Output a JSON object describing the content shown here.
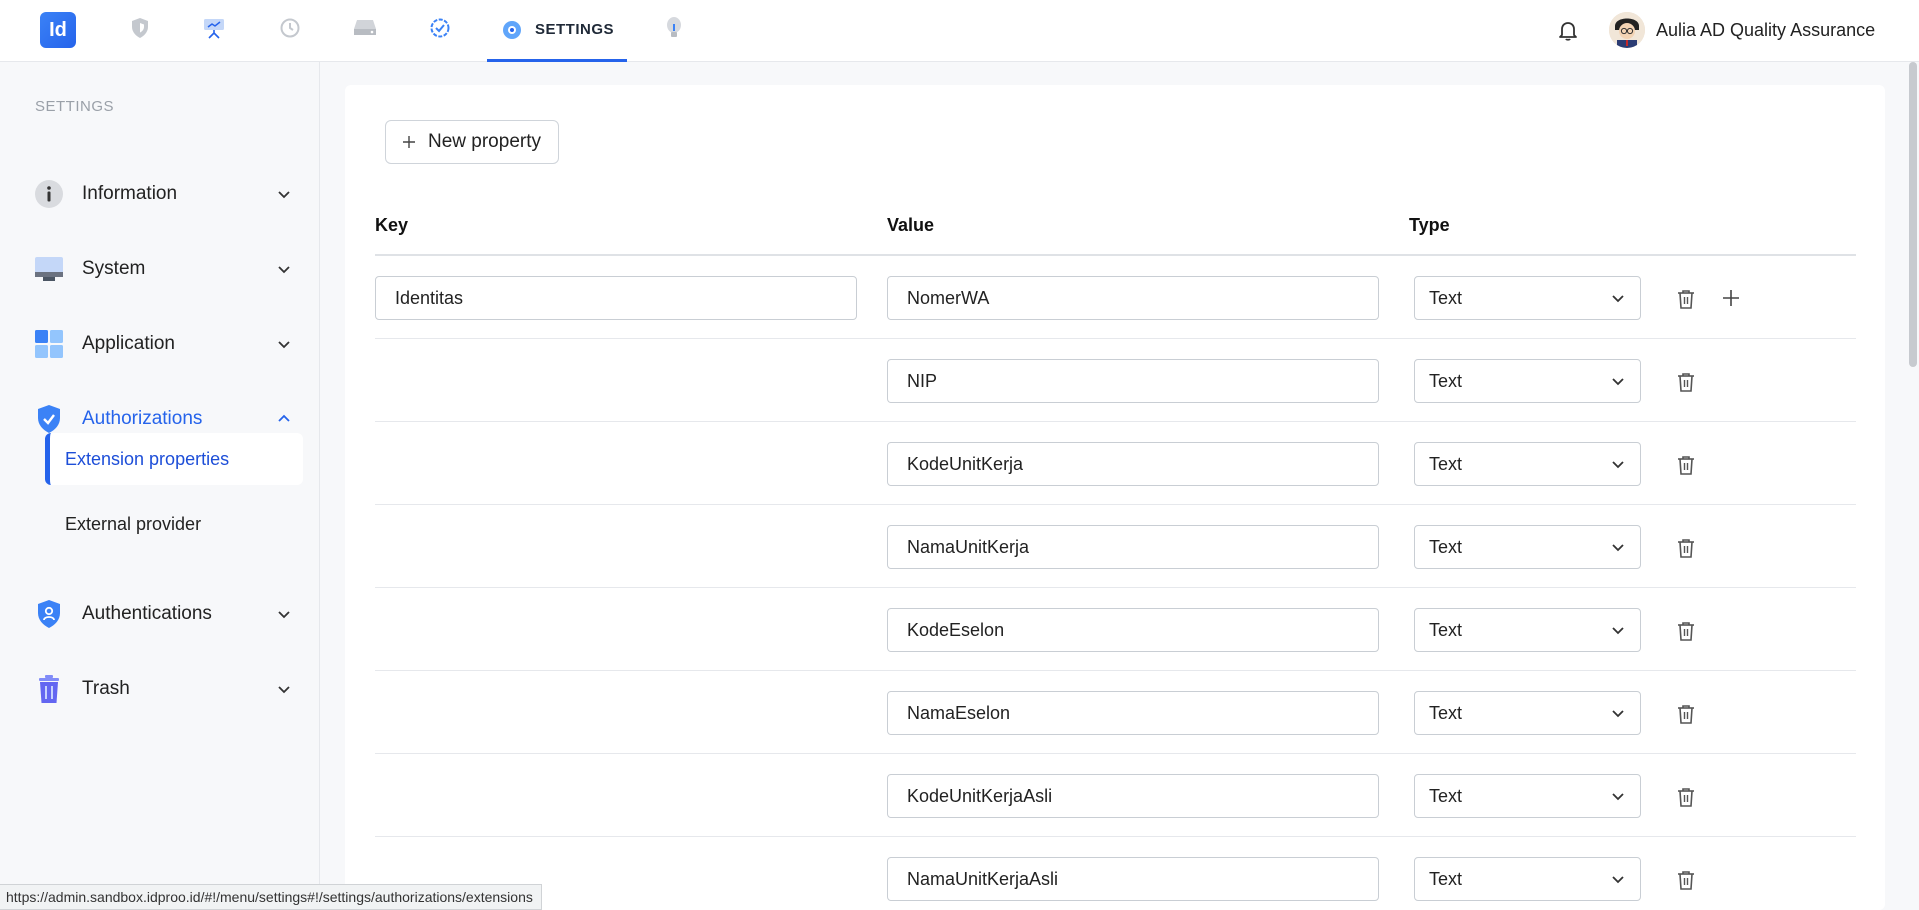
{
  "header": {
    "logo_text": "Id",
    "active_tab_label": "SETTINGS",
    "user_name": "Aulia AD Quality Assurance",
    "nav_icons": [
      "shield-icon",
      "presentation-icon",
      "history-icon",
      "drive-icon",
      "check-circle-icon",
      "gear-icon",
      "bulb-icon"
    ]
  },
  "sidebar": {
    "heading": "SETTINGS",
    "items": [
      {
        "label": "Information",
        "icon": "info-icon",
        "expanded": false
      },
      {
        "label": "System",
        "icon": "monitor-icon",
        "expanded": false
      },
      {
        "label": "Application",
        "icon": "grid-icon",
        "expanded": false
      },
      {
        "label": "Authorizations",
        "icon": "shield-check-icon",
        "expanded": true
      },
      {
        "label": "Authentications",
        "icon": "shield-user-icon",
        "expanded": false
      },
      {
        "label": "Trash",
        "icon": "trash-icon",
        "expanded": false
      }
    ],
    "subitems": [
      {
        "label": "Extension properties",
        "active": true
      },
      {
        "label": "External provider",
        "active": false
      }
    ]
  },
  "main": {
    "new_property_label": "New property",
    "columns": {
      "key": "Key",
      "value": "Value",
      "type": "Type"
    },
    "rows": [
      {
        "key": "Identitas",
        "value": "NomerWA",
        "type": "Text"
      },
      {
        "key": "",
        "value": "NIP",
        "type": "Text"
      },
      {
        "key": "",
        "value": "KodeUnitKerja",
        "type": "Text"
      },
      {
        "key": "",
        "value": "NamaUnitKerja",
        "type": "Text"
      },
      {
        "key": "",
        "value": "KodeEselon",
        "type": "Text"
      },
      {
        "key": "",
        "value": "NamaEselon",
        "type": "Text"
      },
      {
        "key": "",
        "value": "KodeUnitKerjaAsli",
        "type": "Text"
      },
      {
        "key": "",
        "value": "NamaUnitKerjaAsli",
        "type": "Text"
      }
    ]
  },
  "status_bar": {
    "url": "https://admin.sandbox.idproo.id/#!/menu/settings#!/settings/authorizations/extensions"
  },
  "colors": {
    "accent": "#2563eb",
    "border": "#c9ced4"
  }
}
